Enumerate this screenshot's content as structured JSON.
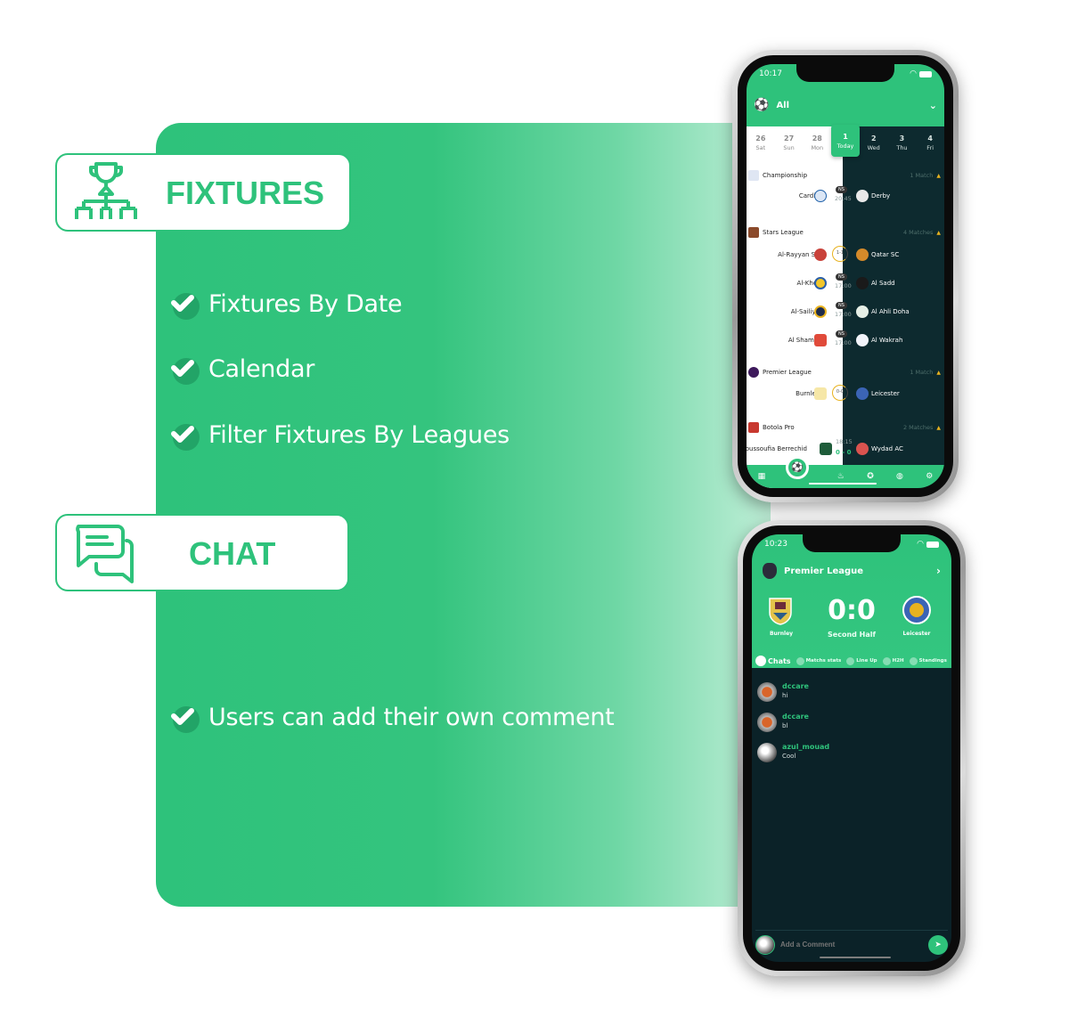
{
  "sections": {
    "fixtures": {
      "title": "FIXTURES",
      "icon": "tournament-bracket-icon",
      "bullets": [
        "Fixtures By Date",
        "Calendar",
        "Filter Fixtures By Leagues"
      ]
    },
    "chat": {
      "title": "CHAT",
      "icon": "chat-bubbles-icon",
      "bullets": [
        "Users can add their own comment"
      ]
    }
  },
  "colors": {
    "accent": "#2ec27b",
    "dark_bg": "#0d2a2f",
    "live_ring": "#e8b21f"
  },
  "phone1": {
    "time": "10:17",
    "filter_label": "All",
    "dates": [
      {
        "num": "26",
        "day": "Sat"
      },
      {
        "num": "27",
        "day": "Sun"
      },
      {
        "num": "28",
        "day": "Mon"
      },
      {
        "num": "1",
        "day": "Today"
      },
      {
        "num": "2",
        "day": "Wed"
      },
      {
        "num": "3",
        "day": "Thu"
      },
      {
        "num": "4",
        "day": "Fri"
      }
    ],
    "leagues": [
      {
        "name": "Championship",
        "count": "1 Match",
        "matches": [
          {
            "home": "Cardiff",
            "away": "Derby",
            "status": "NS",
            "time": "20:45"
          }
        ]
      },
      {
        "name": "Stars League",
        "count": "4 Matches",
        "matches": [
          {
            "home": "Al-Rayyan SC",
            "away": "Qatar SC",
            "score": "1-1",
            "live": true
          },
          {
            "home": "Al-Khor",
            "away": "Al Sadd",
            "status": "NS",
            "time": "17:00"
          },
          {
            "home": "Al-Sailiya",
            "away": "Al Ahli Doha",
            "status": "NS",
            "time": "17:00"
          },
          {
            "home": "Al Shamal",
            "away": "Al Wakrah",
            "status": "NS",
            "time": "17:00"
          }
        ]
      },
      {
        "name": "Premier League",
        "count": "1 Match",
        "matches": [
          {
            "home": "Burnley",
            "away": "Leicester",
            "score": "0-0",
            "live": true
          }
        ]
      },
      {
        "name": "Botola Pro",
        "count": "2 Matches",
        "matches": [
          {
            "home": "Youssoufia Berrechid",
            "away": "Wydad AC",
            "time": "18:15",
            "score": "0 - 0"
          }
        ]
      }
    ],
    "tabbar": [
      "calendar-icon",
      "football-icon",
      "fire-icon",
      "award-icon",
      "globe-icon",
      "settings-icon"
    ]
  },
  "phone2": {
    "time": "10:23",
    "league": "Premier League",
    "home_team": "Burnley",
    "away_team": "Leicester",
    "score": "0:0",
    "period": "Second Half",
    "tabs": [
      "Chats",
      "Matchs stats",
      "Line Up",
      "H2H",
      "Standings"
    ],
    "messages": [
      {
        "user": "dccare",
        "text": "hi"
      },
      {
        "user": "dccare",
        "text": "bl"
      },
      {
        "user": "azul_mouad",
        "text": "Cool"
      }
    ],
    "composer_placeholder": "Add a Comment"
  }
}
